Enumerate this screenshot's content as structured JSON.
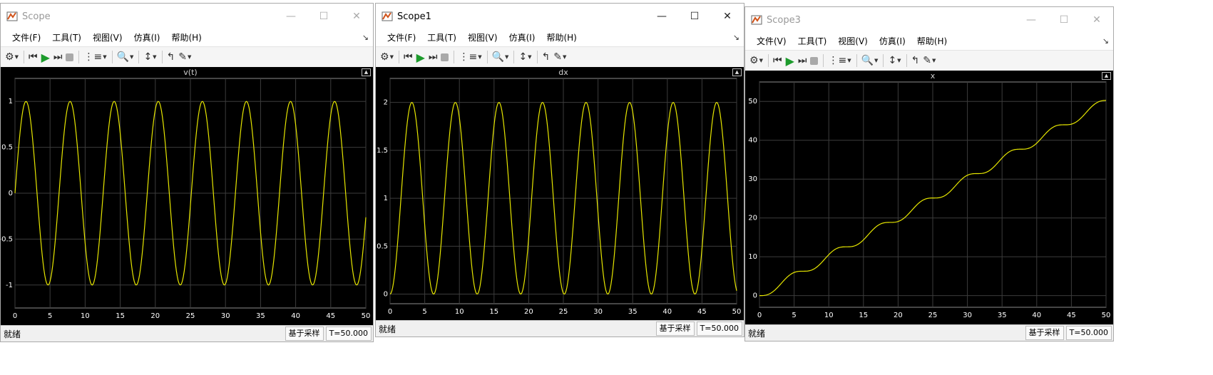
{
  "windows": [
    {
      "title": "Scope",
      "active": false,
      "menus": [
        "文件(F)",
        "工具(T)",
        "视图(V)",
        "仿真(I)",
        "帮助(H)"
      ],
      "status_left": "就绪",
      "status_mode": "基于采样",
      "status_time": "T=50.000"
    },
    {
      "title": "Scope1",
      "active": true,
      "menus": [
        "文件(F)",
        "工具(T)",
        "视图(V)",
        "仿真(I)",
        "帮助(H)"
      ],
      "status_left": "就绪",
      "status_mode": "基于采样",
      "status_time": "T=50.000"
    },
    {
      "title": "Scope3",
      "active": false,
      "menus": [
        "文件(V)",
        "工具(T)",
        "视图(V)",
        "仿真(I)",
        "帮助(H)"
      ],
      "status_left": "就绪",
      "status_mode": "基于采样",
      "status_time": "T=50.000"
    }
  ],
  "toolbar_icons": [
    "gear-icon",
    "step-back-icon",
    "run-icon",
    "step-forward-icon",
    "stop-icon",
    "highlight-icon",
    "zoom-icon",
    "scale-axes-icon",
    "triggers-icon",
    "measurements-icon"
  ],
  "colors": {
    "trace": "#e6e600",
    "plot_bg": "#000000",
    "grid": "#3c3c3c",
    "axis_text": "#ffffff"
  },
  "chart_data": [
    {
      "type": "line",
      "title": "v(t)",
      "xlim": [
        0,
        50
      ],
      "ylim": [
        -1.25,
        1.25
      ],
      "xticks": [
        "0",
        "5",
        "10",
        "15",
        "20",
        "25",
        "30",
        "35",
        "40",
        "45",
        "50"
      ],
      "yticks": [
        "-1",
        "-0.5",
        "0",
        "0.5",
        "1"
      ],
      "series": [
        {
          "expr": "sin(t)",
          "samples": 401
        }
      ]
    },
    {
      "type": "line",
      "title": "dx",
      "xlim": [
        0,
        50
      ],
      "ylim": [
        -0.1,
        2.25
      ],
      "xticks": [
        "0",
        "5",
        "10",
        "15",
        "20",
        "25",
        "30",
        "35",
        "40",
        "45",
        "50"
      ],
      "yticks": [
        "0",
        "0.5",
        "1",
        "1.5",
        "2"
      ],
      "series": [
        {
          "expr": "1 - cos(t)",
          "samples": 401
        }
      ]
    },
    {
      "type": "line",
      "title": "x",
      "xlim": [
        0,
        50
      ],
      "ylim": [
        -3,
        55
      ],
      "xticks": [
        "0",
        "5",
        "10",
        "15",
        "20",
        "25",
        "30",
        "35",
        "40",
        "45",
        "50"
      ],
      "yticks": [
        "0",
        "10",
        "20",
        "30",
        "40",
        "50"
      ],
      "series": [
        {
          "expr": "t - sin(t)",
          "samples": 401
        }
      ]
    }
  ]
}
